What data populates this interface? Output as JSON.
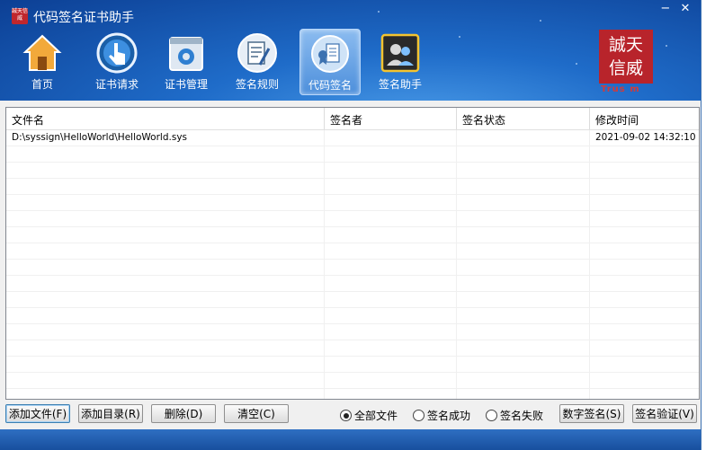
{
  "window": {
    "title": "代码签名证书助手",
    "app_icon_text": "誠天信威"
  },
  "toolbar": {
    "items": [
      {
        "label": "首页",
        "icon": "home-icon"
      },
      {
        "label": "证书请求",
        "icon": "hand-pointer-icon"
      },
      {
        "label": "证书管理",
        "icon": "gear-box-icon"
      },
      {
        "label": "签名规则",
        "icon": "document-pen-icon"
      },
      {
        "label": "代码签名",
        "icon": "certificate-icon",
        "active": true
      },
      {
        "label": "签名助手",
        "icon": "users-icon"
      }
    ]
  },
  "logo": {
    "line1": "誠天",
    "line2": "信威",
    "sub": "Trus  m"
  },
  "table": {
    "columns": [
      "文件名",
      "签名者",
      "签名状态",
      "修改时间"
    ],
    "rows": [
      [
        "D:\\syssign\\HelloWorld\\HelloWorld.sys",
        "",
        "",
        "2021-09-02 14:32:10"
      ]
    ]
  },
  "bottom": {
    "add_file": "添加文件(F)",
    "add_dir": "添加目录(R)",
    "delete": "删除(D)",
    "clear": "清空(C)",
    "filter_all": "全部文件",
    "filter_success": "签名成功",
    "filter_fail": "签名失败",
    "digital_sign": "数字签名(S)",
    "verify": "签名验证(V)"
  },
  "colors": {
    "title_bg": "#1f6cc9",
    "brand_red": "#b8242b"
  }
}
